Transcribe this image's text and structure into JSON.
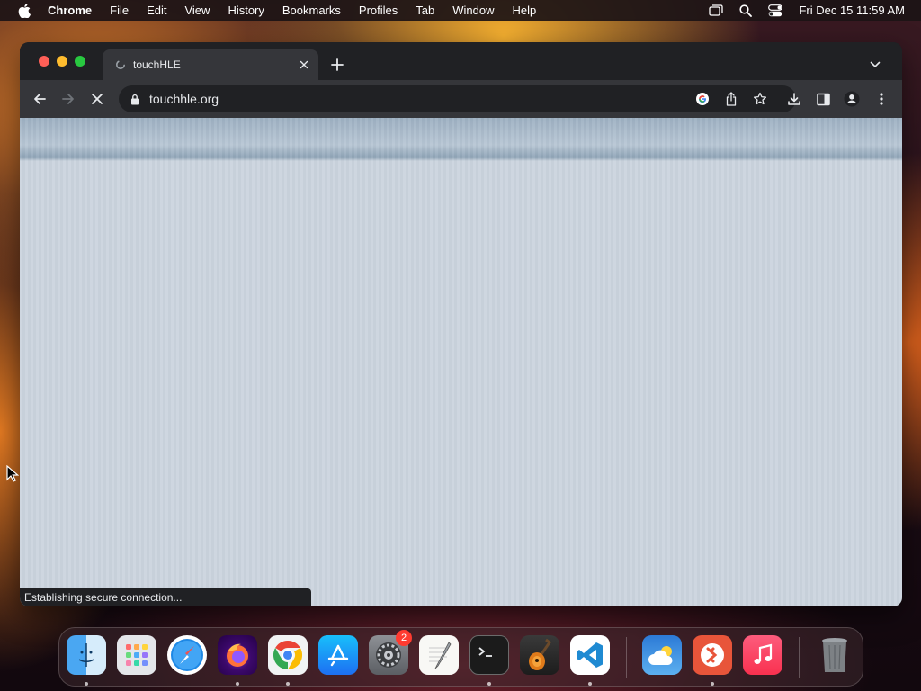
{
  "menubar": {
    "app_name": "Chrome",
    "items": [
      "File",
      "Edit",
      "View",
      "History",
      "Bookmarks",
      "Profiles",
      "Tab",
      "Window",
      "Help"
    ],
    "clock": "Fri Dec 15  11:59 AM",
    "status_icons": [
      "screen-mirroring-icon",
      "spotlight-search-icon",
      "control-center-icon"
    ]
  },
  "browser": {
    "tab": {
      "title": "touchHLE",
      "favicon": "loading-spinner-icon"
    },
    "address_bar": {
      "url": "touchhle.org",
      "security": "lock-icon"
    },
    "status_text": "Establishing secure connection...",
    "toolbar_icons": [
      "back-arrow-icon",
      "forward-arrow-icon",
      "stop-loading-icon",
      "google-lens-icon",
      "share-icon",
      "bookmark-star-icon",
      "download-icon",
      "side-panel-icon",
      "profile-icon",
      "more-menu-icon"
    ]
  },
  "dock": {
    "apps": [
      {
        "name": "Finder",
        "icon": "finder-icon"
      },
      {
        "name": "Launchpad",
        "icon": "launchpad-icon"
      },
      {
        "name": "Safari",
        "icon": "safari-icon"
      },
      {
        "name": "Firefox",
        "icon": "firefox-icon"
      },
      {
        "name": "Google Chrome",
        "icon": "chrome-icon"
      },
      {
        "name": "App Store",
        "icon": "app-store-icon"
      },
      {
        "name": "System Settings",
        "icon": "system-settings-icon",
        "badge": "2"
      },
      {
        "name": "TextEdit",
        "icon": "textedit-icon"
      },
      {
        "name": "Terminal",
        "icon": "terminal-icon"
      },
      {
        "name": "GarageBand",
        "icon": "garageband-icon"
      },
      {
        "name": "Visual Studio Code",
        "icon": "vscode-icon"
      },
      {
        "name": "Weather",
        "icon": "weather-icon"
      },
      {
        "name": "Remote Desktop",
        "icon": "remote-desktop-icon"
      },
      {
        "name": "Music",
        "icon": "music-icon"
      },
      {
        "name": "Trash",
        "icon": "trash-icon"
      }
    ]
  },
  "colors": {
    "window_bg": "#202124",
    "toolbar_bg": "#35363a",
    "content_bg": "#cbd4de",
    "badge": "#ff3b30"
  }
}
